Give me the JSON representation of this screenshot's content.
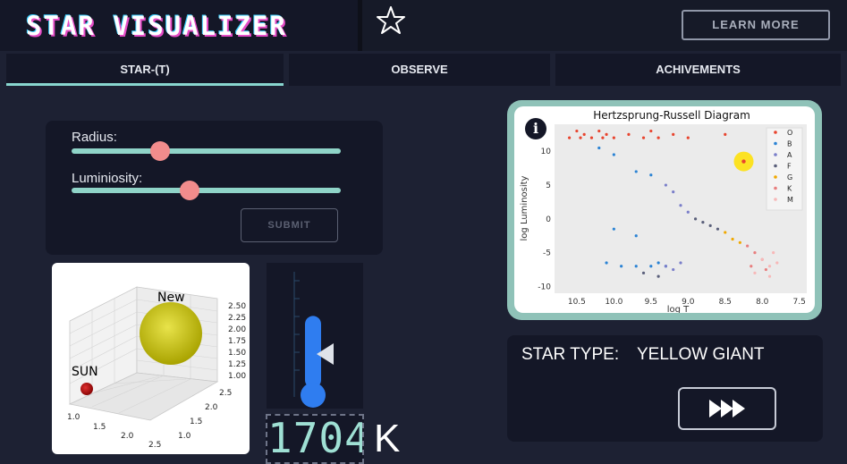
{
  "app": {
    "title": "STAR VISUALIZER",
    "learn_more": "LEARN MORE",
    "favorite_icon": "star-outline-icon"
  },
  "tabs": [
    {
      "label": "STAR-(T)",
      "active": true
    },
    {
      "label": "OBSERVE",
      "active": false
    },
    {
      "label": "ACHIVEMENTS",
      "active": false
    }
  ],
  "controls": {
    "radius_label": "Radius:",
    "luminosity_label": "Luminiosity:",
    "radius_level": 0.33,
    "luminosity_level": 0.44,
    "submit_label": "SUBMIT"
  },
  "plot3d": {
    "sun_label": "SUN",
    "new_label": "New",
    "z_ticks": [
      "2.50",
      "2.25",
      "2.00",
      "1.75",
      "1.50",
      "1.25",
      "1.00"
    ],
    "x_ticks": [
      "1.0",
      "1.5",
      "2.0",
      "2.5"
    ],
    "y_ticks": [
      "1.0",
      "1.5",
      "2.0",
      "2.5"
    ],
    "sun_color": "#b01010",
    "new_color": "#c9c400"
  },
  "thermometer": {
    "level": 0.62,
    "value": "1704",
    "unit": "K",
    "color": "#2f7df0"
  },
  "hr_diagram": {
    "info_icon": "info-icon",
    "chart_data": {
      "type": "scatter",
      "title": "Hertzsprung-Russell Diagram",
      "xlabel": "log T",
      "ylabel": "log Luminosity",
      "xlim": [
        10.8,
        7.4
      ],
      "ylim": [
        -11,
        14
      ],
      "xticks": [
        "10.5",
        "10.0",
        "9.5",
        "9.0",
        "8.5",
        "8.0",
        "7.5"
      ],
      "yticks": [
        "10",
        "5",
        "0",
        "-5",
        "-10"
      ],
      "legend": [
        "O",
        "B",
        "A",
        "F",
        "G",
        "K",
        "M"
      ],
      "legend_colors": [
        "#e8442e",
        "#2b83d4",
        "#7a7ec9",
        "#5a5f7a",
        "#f0a800",
        "#e87e7e",
        "#f7b8b8"
      ],
      "highlight": {
        "x": 8.25,
        "y": 8.5,
        "color": "#ffe100"
      },
      "series": [
        {
          "name": "O",
          "points": [
            [
              10.6,
              12
            ],
            [
              10.5,
              13
            ],
            [
              10.4,
              12.5
            ],
            [
              10.3,
              12
            ],
            [
              10.2,
              13
            ],
            [
              10.1,
              12.5
            ],
            [
              10.0,
              12
            ],
            [
              9.8,
              12.5
            ],
            [
              9.6,
              12
            ],
            [
              9.5,
              13
            ],
            [
              9.4,
              12
            ],
            [
              9.2,
              12.5
            ],
            [
              9.0,
              12
            ],
            [
              8.5,
              12.5
            ],
            [
              10.45,
              12
            ],
            [
              10.15,
              12
            ]
          ]
        },
        {
          "name": "B",
          "points": [
            [
              10.2,
              10.5
            ],
            [
              10.0,
              9.5
            ],
            [
              9.7,
              7
            ],
            [
              9.5,
              6.5
            ],
            [
              10.0,
              -1.5
            ],
            [
              9.7,
              -2.5
            ],
            [
              10.1,
              -6.5
            ],
            [
              9.9,
              -7
            ],
            [
              9.7,
              -7
            ],
            [
              9.5,
              -7
            ],
            [
              9.4,
              -6.5
            ],
            [
              9.3,
              -7
            ]
          ]
        },
        {
          "name": "A",
          "points": [
            [
              9.3,
              5
            ],
            [
              9.2,
              4
            ],
            [
              9.1,
              2
            ],
            [
              9.0,
              1
            ],
            [
              9.3,
              -7
            ],
            [
              9.2,
              -7.5
            ],
            [
              9.1,
              -6.5
            ]
          ]
        },
        {
          "name": "F",
          "points": [
            [
              8.9,
              0
            ],
            [
              8.8,
              -0.5
            ],
            [
              8.7,
              -1
            ],
            [
              8.6,
              -1.5
            ],
            [
              9.6,
              -8
            ],
            [
              9.4,
              -8.5
            ]
          ]
        },
        {
          "name": "G",
          "points": [
            [
              8.5,
              -2
            ],
            [
              8.4,
              -3
            ],
            [
              8.3,
              -3.5
            ]
          ]
        },
        {
          "name": "K",
          "points": [
            [
              8.2,
              -4
            ],
            [
              8.1,
              -5
            ],
            [
              8.0,
              -6
            ],
            [
              8.15,
              -7
            ],
            [
              7.95,
              -7.5
            ]
          ]
        },
        {
          "name": "M",
          "points": [
            [
              8.0,
              -6
            ],
            [
              7.9,
              -7
            ],
            [
              7.85,
              -5
            ],
            [
              8.1,
              -8
            ],
            [
              7.9,
              -8.5
            ],
            [
              7.8,
              -6.5
            ]
          ]
        }
      ]
    }
  },
  "star_type": {
    "label": "STAR TYPE:",
    "value": "YELLOW GIANT",
    "next_icon": "fast-forward-icon"
  }
}
